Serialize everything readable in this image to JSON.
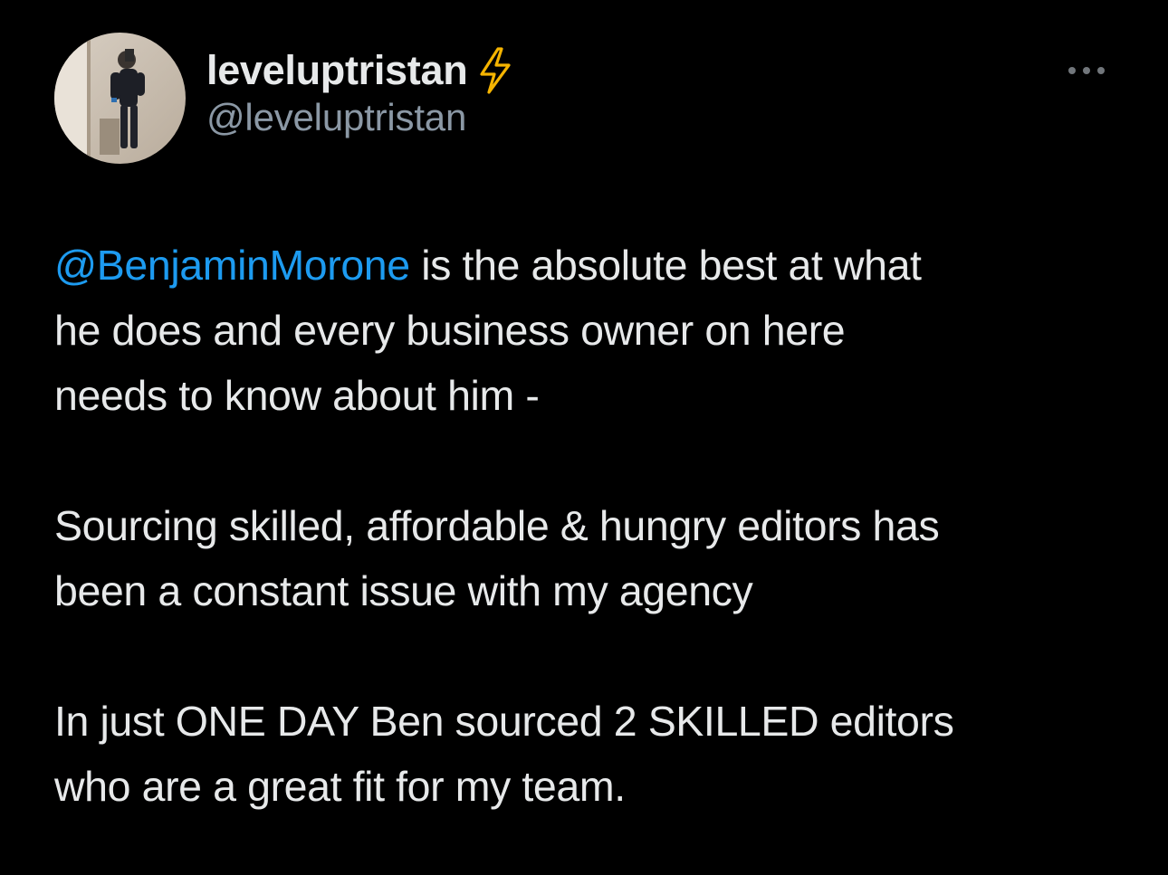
{
  "tweet": {
    "author": {
      "display_name": "leveluptristan",
      "handle": "@leveluptristan",
      "verified_icon": "lightning-bolt-icon",
      "avatar": "profile-photo"
    },
    "more_icon": "more-options-icon",
    "body": {
      "mention": "@BenjaminMorone",
      "paragraph1_lines": [
        " is the absolute best at what",
        "he does and every business owner on here",
        "needs to know about him -"
      ],
      "paragraph2_lines": [
        "Sourcing skilled, affordable & hungry editors has",
        "been a constant issue with my agency"
      ],
      "paragraph3_lines": [
        "In just ONE DAY Ben sourced 2 SKILLED editors",
        "who are a great fit for my team."
      ]
    }
  },
  "colors": {
    "background": "#000000",
    "text": "#e7e9ea",
    "secondary_text": "#8b98a5",
    "link": "#1d9bf0",
    "bolt": "#f5b400"
  }
}
